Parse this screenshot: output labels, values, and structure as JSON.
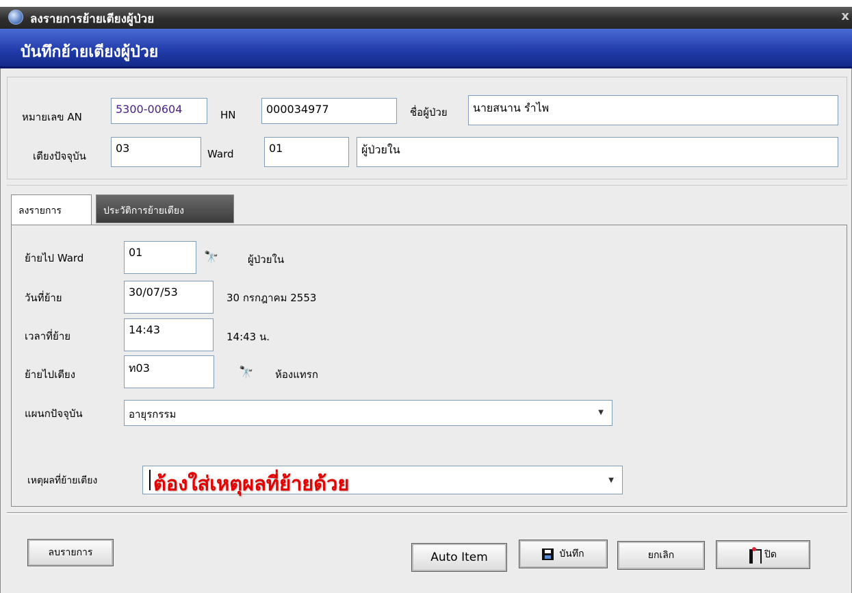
{
  "window": {
    "title": "ลงรายการย้ายเตียงผู้ป่วย",
    "close": "x"
  },
  "header": {
    "title": "บันทึกย้ายเตียงผู้ป่วย"
  },
  "patient": {
    "an_label": "หมายเลข AN",
    "an_value": "5300-00604",
    "hn_label": "HN",
    "hn_value": "000034977",
    "name_label": "ชื่อผู้ป่วย",
    "name_value": "นายสนาน รำไพ",
    "bed_label": "เตียงปัจจุบัน",
    "bed_value": "03",
    "ward_label": "Ward",
    "ward_value": "01",
    "ward_name": "ผู้ป่วยใน"
  },
  "tabs": {
    "entry": "ลงรายการ",
    "history": "ประวัติการย้ายเตียง"
  },
  "form": {
    "move_ward_label": "ย้ายไป Ward",
    "move_ward_value": "01",
    "move_ward_name": "ผู้ป่วยใน",
    "date_label": "วันที่ย้าย",
    "date_value": "30/07/53",
    "date_text": "30 กรกฎาคม 2553",
    "time_label": "เวลาที่ย้าย",
    "time_value": "14:43",
    "time_text": "14:43 น.",
    "bed_label": "ย้ายไปเตียง",
    "bed_value": "ท03",
    "bed_name": "ห้องแทรก",
    "dept_label": "แผนกปัจจุบัน",
    "dept_value": "อายุรกรรม",
    "reason_label": "เหตุผลที่ย้ายเตียง",
    "reason_warning": "ต้องใส่เหตุผลที่ย้ายด้วย"
  },
  "buttons": {
    "delete": "ลบรายการ",
    "auto": "Auto Item",
    "save": "บันทึก",
    "cancel": "ยกเลิก",
    "close": "ปิด"
  }
}
